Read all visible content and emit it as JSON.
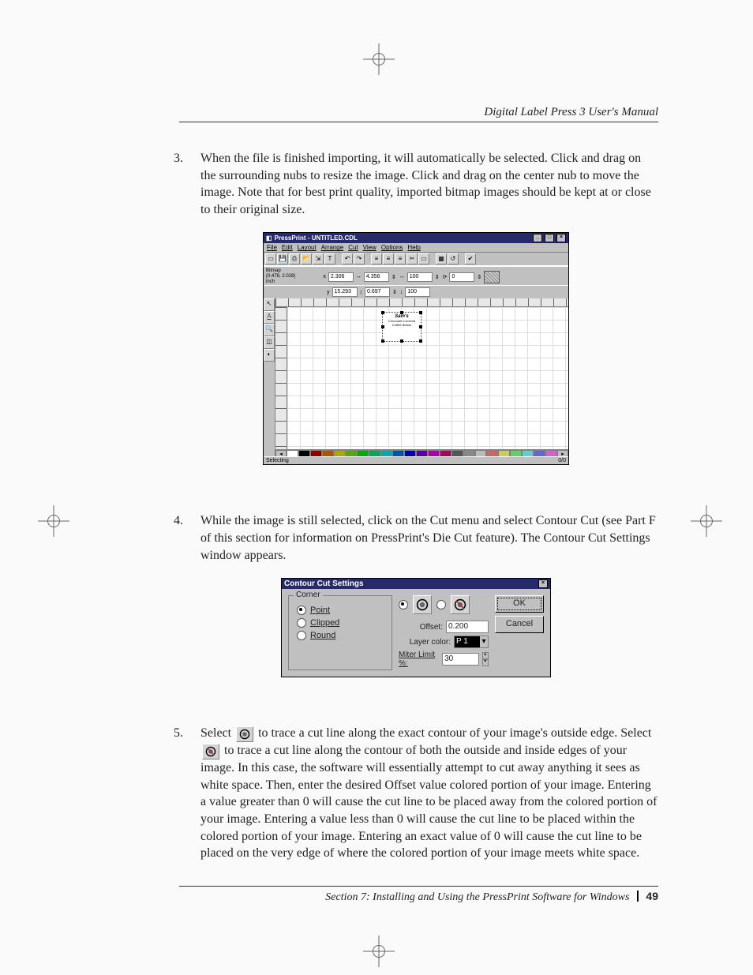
{
  "header": {
    "title": "Digital Label Press 3 User's Manual"
  },
  "footer": {
    "section": "Section 7:  Installing and Using the PressPrint Software for Windows",
    "page": "49"
  },
  "steps": {
    "s3": {
      "num": "3.",
      "text": "When the file is finished importing, it will automatically be selected. Click and drag on the surrounding nubs to resize the image. Click and drag on the center nub to move the image. Note that for best print quality, imported bitmap images should be kept at or close to their original size."
    },
    "s4": {
      "num": "4.",
      "text": "While the image is still selected, click on the Cut menu and select Contour Cut (see Part F of this section for information on PressPrint's Die Cut feature). The Contour Cut Settings window appears."
    },
    "s5": {
      "num": "5.",
      "t1": "Select ",
      "t2": " to trace a cut line along the exact contour of your image's outside edge.  Select ",
      "t3": " to trace a cut line along the contour of both the outside and inside edges of your image. In this case, the software will essentially attempt to cut away anything it sees as white space. Then, enter the desired Offset value colored portion of your image. Entering a value greater than 0 will cause the cut line to be placed away from the colored portion of your image. Entering a value less than 0 will cause the cut line to be placed within the colored portion of your image. Entering an exact value of 0 will cause the cut line to be placed on the very edge of where the colored portion of your image meets white space."
    }
  },
  "app": {
    "title": "PressPrint - UNTITLED.CDL",
    "menus": [
      "File",
      "Edit",
      "Layout",
      "Arrange",
      "Cut",
      "View",
      "Options",
      "Help"
    ],
    "info": {
      "type": "Bitmap",
      "coords": "(0.478, 2.028)",
      "unit": "inch"
    },
    "props": {
      "x": "2.306",
      "y": "15.293",
      "w": "4.356",
      "h": "0.697",
      "sw": "100",
      "sh": "100",
      "rot": "0"
    },
    "label": {
      "line1": "Sam's",
      "line2": "Chocolate Covered",
      "line3": "Coffee Beans"
    },
    "status_left": "Selecting",
    "status_right": "0/0"
  },
  "dialog": {
    "title": "Contour Cut Settings",
    "corner_legend": "Corner",
    "corner_opts": {
      "point": "Point",
      "clipped": "Clipped",
      "round": "Round"
    },
    "offset_label": "Offset:",
    "offset_value": "0.200",
    "layer_label": "Layer color:",
    "layer_value": "P     1",
    "miter_label": "Miter Limit  %:",
    "miter_value": "30",
    "ok": "OK",
    "cancel": "Cancel"
  }
}
